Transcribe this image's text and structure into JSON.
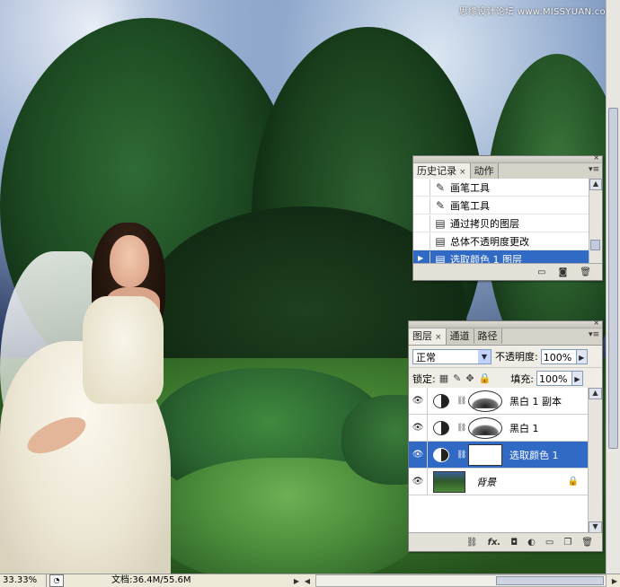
{
  "watermark": "思缘设计论坛 www.MISSYUAN.com",
  "history_panel": {
    "tabs": [
      {
        "label": "历史记录",
        "close": "×"
      },
      {
        "label": "动作"
      }
    ],
    "items": [
      {
        "label": "画笔工具",
        "icon": "brush-icon"
      },
      {
        "label": "画笔工具",
        "icon": "brush-icon"
      },
      {
        "label": "通过拷贝的图层",
        "icon": "history-state-icon"
      },
      {
        "label": "总体不透明度更改",
        "icon": "history-state-icon"
      },
      {
        "label": "选取颜色 1 图层",
        "icon": "history-state-icon",
        "selected": true
      }
    ],
    "menu": "▾≡",
    "footer_icons": [
      "new-document-icon",
      "camera-snapshot-icon",
      "trash-icon"
    ]
  },
  "layers_panel": {
    "tabs": [
      {
        "label": "图层",
        "close": "×"
      },
      {
        "label": "通道"
      },
      {
        "label": "路径"
      }
    ],
    "menu": "▾≡",
    "blend_mode": "正常",
    "opacity_label": "不透明度:",
    "opacity_value": "100%",
    "lock_label": "锁定:",
    "fill_label": "填充:",
    "fill_value": "100%",
    "layers": [
      {
        "name": "黑白 1 副本",
        "type": "adjustment"
      },
      {
        "name": "黑白 1",
        "type": "adjustment"
      },
      {
        "name": "选取颜色 1",
        "type": "adjustment",
        "selected": true
      },
      {
        "name": "背景",
        "type": "background",
        "locked": true
      }
    ],
    "footer_icons": [
      "link-icon",
      "fx-icon",
      "mask-icon",
      "adjustment-layer-icon",
      "folder-icon",
      "new-layer-icon",
      "trash-icon"
    ],
    "footer_fx": "fx."
  },
  "status_bar": {
    "zoom": "33.33%",
    "doc_info": "文档:36.4M/55.6M"
  },
  "glyphs": {
    "eye": "👁",
    "dropdown": "▼",
    "arrow_right": "▶",
    "arrow_up": "▲",
    "arrow_down": "▼",
    "link": "⛓",
    "lock": "🔒"
  }
}
